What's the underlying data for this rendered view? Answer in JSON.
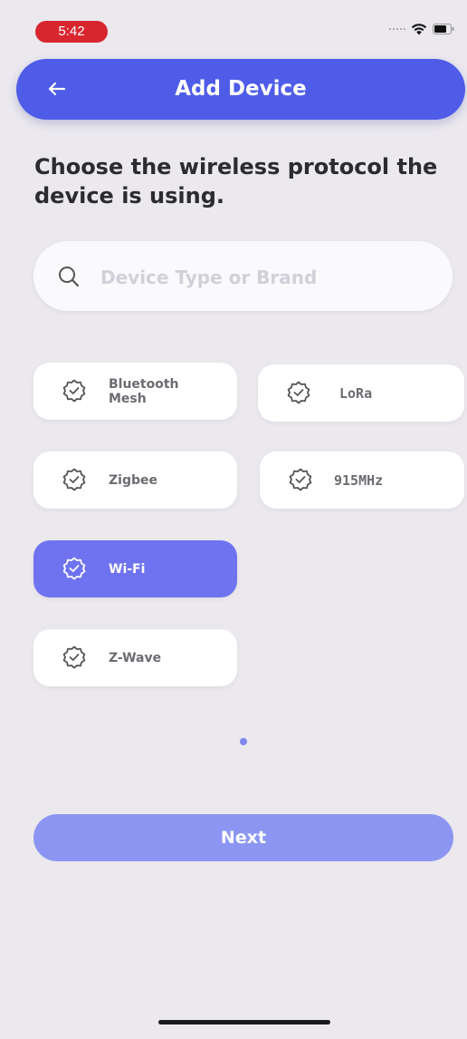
{
  "status_bar": {
    "time": "5:42",
    "time_badge_color": "#d8262e"
  },
  "header": {
    "title": "Add Device",
    "back_icon": "arrow-left-icon",
    "color": "#4e5ce8"
  },
  "prompt": "Choose the wireless protocol the device is using.",
  "search": {
    "placeholder": "Device Type or Brand",
    "value": "",
    "icon": "search-icon"
  },
  "protocols": [
    {
      "label": "Bluetooth\nMesh",
      "selected": false,
      "icon": "badge-check-icon"
    },
    {
      "label": "LoRa",
      "selected": false,
      "icon": "badge-check-icon"
    },
    {
      "label": "Zigbee",
      "selected": false,
      "icon": "badge-check-icon"
    },
    {
      "label": "915MHz",
      "selected": false,
      "icon": "badge-check-icon"
    },
    {
      "label": "Wi-Fi",
      "selected": true,
      "icon": "badge-check-icon"
    },
    {
      "label": "Z-Wave",
      "selected": false,
      "icon": "badge-check-icon"
    }
  ],
  "pagination": {
    "pages": 1,
    "current": 1
  },
  "next_button": {
    "label": "Next",
    "color": "#8c96f2"
  },
  "colors": {
    "accent": "#4e5ce8",
    "selected_chip": "#6f73f0",
    "background": "#ebe8ee"
  }
}
